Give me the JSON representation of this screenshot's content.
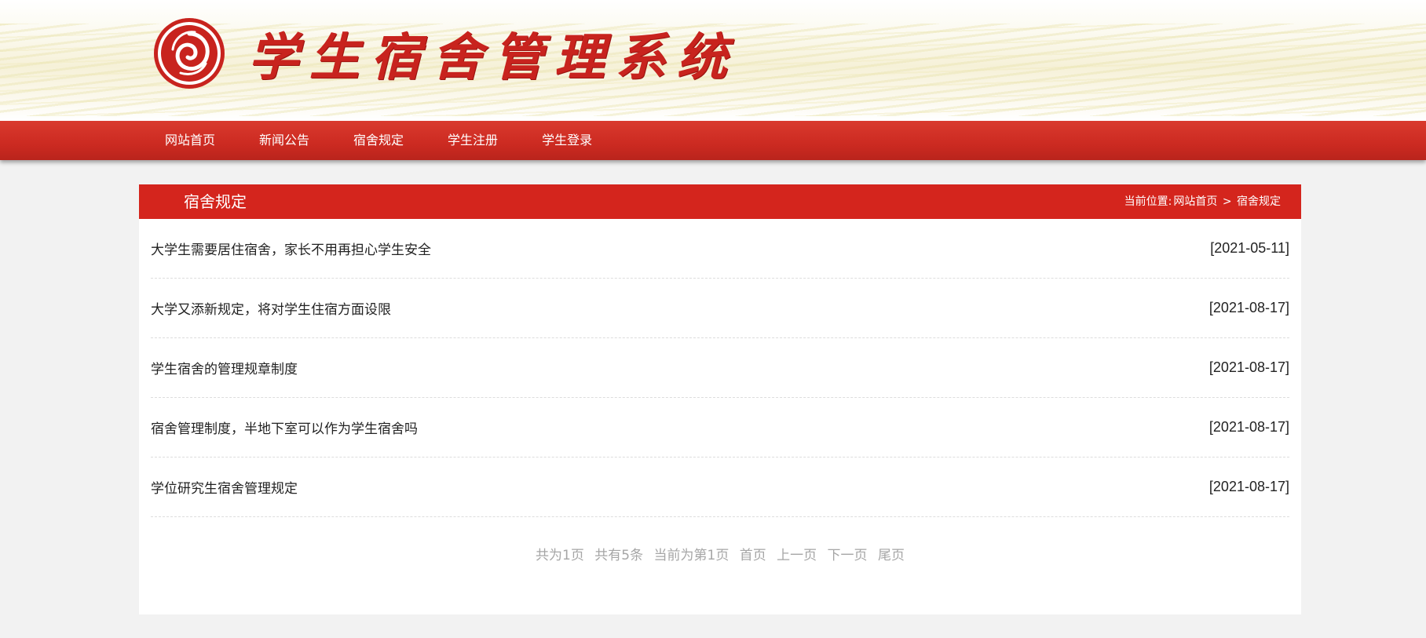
{
  "header": {
    "site_title": "学生宿舍管理系统",
    "logo_icon": "spiral-seal-logo-icon",
    "brand_color": "#c8231e"
  },
  "nav": {
    "items": [
      {
        "label": "网站首页"
      },
      {
        "label": "新闻公告"
      },
      {
        "label": "宿舍规定"
      },
      {
        "label": "学生注册"
      },
      {
        "label": "学生登录"
      }
    ],
    "bar_color": "#d42b21"
  },
  "section": {
    "title": "宿舍规定",
    "breadcrumb": {
      "prefix": "当前位置:",
      "home": "网站首页",
      "separator": ">",
      "current": "宿舍规定"
    }
  },
  "articles": [
    {
      "title": "大学生需要居住宿舍，家长不用再担心学生安全",
      "date": "[2021-05-11]"
    },
    {
      "title": "大学又添新规定，将对学生住宿方面设限",
      "date": "[2021-08-17]"
    },
    {
      "title": "学生宿舍的管理规章制度",
      "date": "[2021-08-17]"
    },
    {
      "title": "宿舍管理制度，半地下室可以作为学生宿舍吗",
      "date": "[2021-08-17]"
    },
    {
      "title": "学位研究生宿舍管理规定",
      "date": "[2021-08-17]"
    }
  ],
  "pagination": {
    "total_pages": "共为1页",
    "total_items": "共有5条",
    "current_page": "当前为第1页",
    "first": "首页",
    "prev": "上一页",
    "next": "下一页",
    "last": "尾页"
  }
}
